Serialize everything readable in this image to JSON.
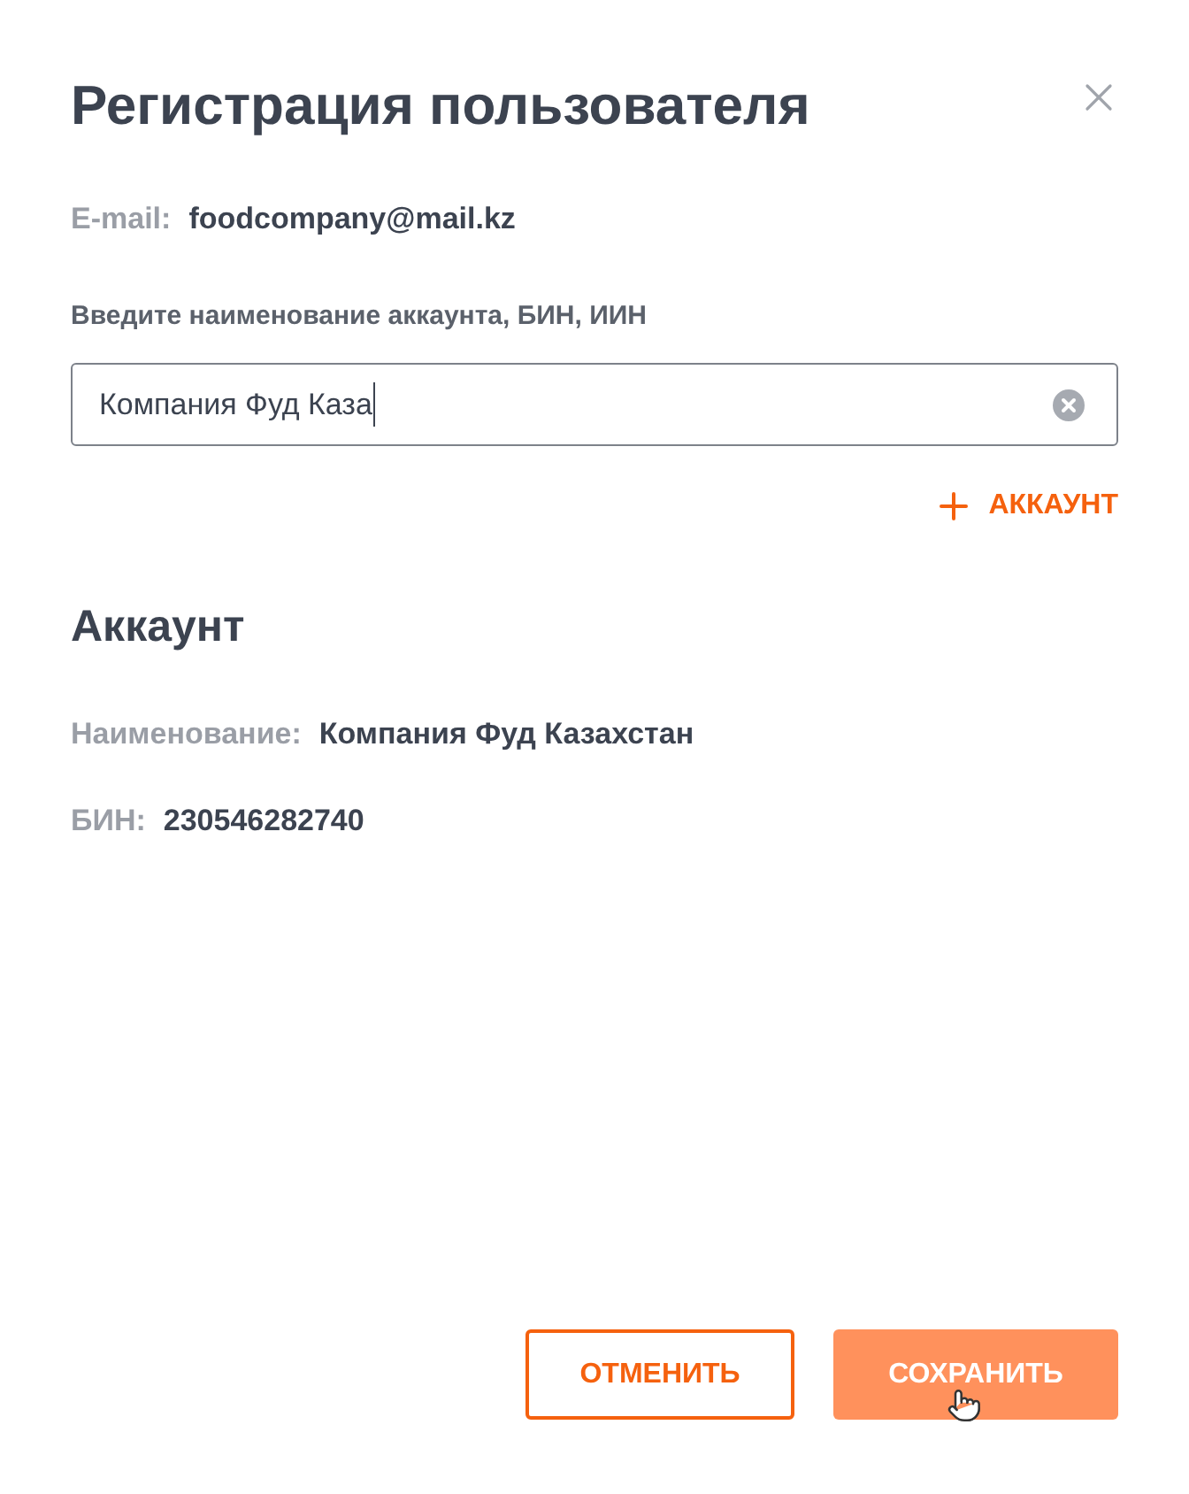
{
  "dialog": {
    "title": "Регистрация пользователя"
  },
  "email": {
    "label": "E-mail:",
    "value": "foodcompany@mail.kz"
  },
  "search": {
    "label": "Введите наименование аккаунта, БИН, ИИН",
    "value": "Компания Фуд Каза"
  },
  "add_account": {
    "label": "АККАУНТ"
  },
  "account": {
    "title": "Аккаунт",
    "fields": [
      {
        "label": "Наименование:",
        "value": "Компания Фуд Казахстан"
      },
      {
        "label": "БИН:",
        "value": "230546282740"
      }
    ]
  },
  "buttons": [
    {
      "kind": "outline",
      "label": "ОТМЕНИТЬ",
      "hovered": false
    },
    {
      "kind": "filled",
      "label": "СОХРАНИТЬ",
      "hovered": true
    }
  ]
}
